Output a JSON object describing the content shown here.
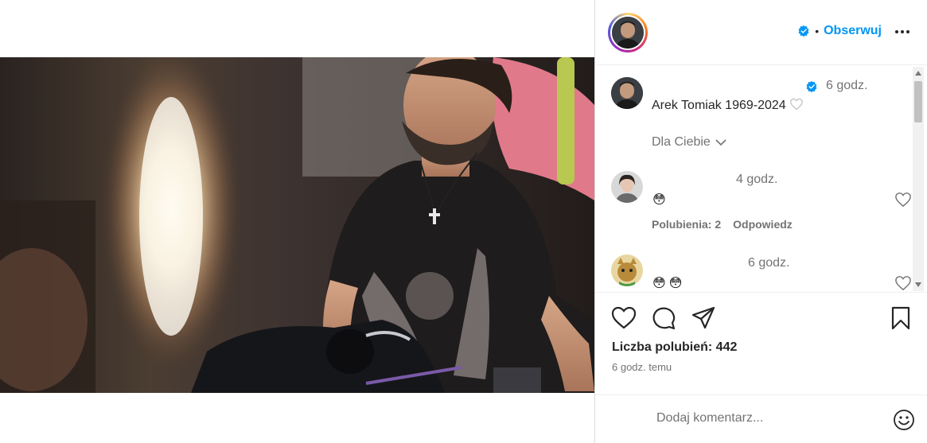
{
  "post": {
    "author": {
      "verified": true
    },
    "follow_separator": "•",
    "follow_label": "Obserwuj",
    "caption": {
      "time": "6 godz.",
      "text": "Arek Tomiak 1969-2024",
      "emoji": "♡"
    },
    "for_you_label": "Dla Ciebie",
    "comments": [
      {
        "time": "4 godz.",
        "text": "😳",
        "likes_label": "Polubienia: 2",
        "reply_label": "Odpowiedz"
      },
      {
        "time": "6 godz.",
        "text": "😳😳"
      }
    ],
    "likes_text": "Liczba polubień: 442",
    "posted_text": "6 godz. temu",
    "add_comment_placeholder": "Dodaj komentarz..."
  },
  "colors": {
    "accent": "#0095f6",
    "text_primary": "#262626",
    "text_secondary": "#737373",
    "border": "#dbdbdb"
  },
  "icons": {
    "more": "more-horizontal-icon",
    "like": "heart-icon",
    "comment": "comment-icon",
    "share": "share-icon",
    "save": "bookmark-icon",
    "emoji": "emoji-smile-icon",
    "verified": "verified-badge-icon"
  }
}
